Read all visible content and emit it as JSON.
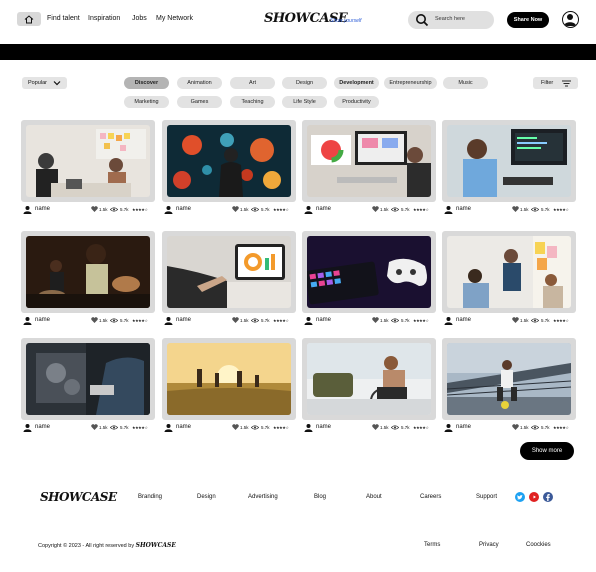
{
  "header": {
    "nav": [
      "Find talent",
      "Inspiration",
      "Jobs",
      "My Network"
    ],
    "logo": "SHOWCASE",
    "tagline": "Show yourself",
    "search_placeholder": "Search here",
    "share_label": "Share Now"
  },
  "filters": {
    "sort_label": "Popular",
    "filter_label": "Filter",
    "categories_row1": [
      "Discover",
      "Animation",
      "Art",
      "Design",
      "Development",
      "Entrepreneurship",
      "Music"
    ],
    "categories_row2": [
      "Marketing",
      "Games",
      "Teaching",
      "Life Style",
      "Productivity"
    ],
    "active_category": "Discover"
  },
  "cards": [
    {
      "name": "name",
      "likes": "1.5k",
      "views": "5.7k",
      "rating": "★★★★☆"
    },
    {
      "name": "name",
      "likes": "1.5k",
      "views": "5.7k",
      "rating": "★★★★☆"
    },
    {
      "name": "name",
      "likes": "1.5k",
      "views": "5.7k",
      "rating": "★★★★☆"
    },
    {
      "name": "name",
      "likes": "1.5k",
      "views": "5.7k",
      "rating": "★★★★☆"
    },
    {
      "name": "name",
      "likes": "1.5k",
      "views": "5.7k",
      "rating": "★★★★☆"
    },
    {
      "name": "name",
      "likes": "1.5k",
      "views": "5.7k",
      "rating": "★★★★☆"
    },
    {
      "name": "name",
      "likes": "1.5k",
      "views": "5.7k",
      "rating": "★★★★☆"
    },
    {
      "name": "name",
      "likes": "1.5k",
      "views": "5.7k",
      "rating": "★★★★☆"
    },
    {
      "name": "name",
      "likes": "1.5k",
      "views": "5.7k",
      "rating": "★★★★☆"
    },
    {
      "name": "name",
      "likes": "1.5k",
      "views": "5.7k",
      "rating": "★★★★☆"
    },
    {
      "name": "name",
      "likes": "1.5k",
      "views": "5.7k",
      "rating": "★★★★☆"
    },
    {
      "name": "name",
      "likes": "1.5k",
      "views": "5.7k",
      "rating": "★★★★☆"
    }
  ],
  "show_more_label": "Show more",
  "footer": {
    "logo": "SHOWCASE",
    "links": [
      "Branding",
      "Design",
      "Advertising",
      "Blog",
      "About",
      "Careers",
      "Support"
    ],
    "copyright": "Copyright © 2023 - All right reserved by",
    "copyright_logo": "SHOWCASE",
    "legal": [
      "Terms",
      "Privacy",
      "Coockies"
    ],
    "social_icons": [
      "twitter-icon",
      "youtube-icon",
      "facebook-icon"
    ],
    "social_colors": [
      "#1da1f2",
      "#e02020",
      "#3b5998"
    ]
  }
}
